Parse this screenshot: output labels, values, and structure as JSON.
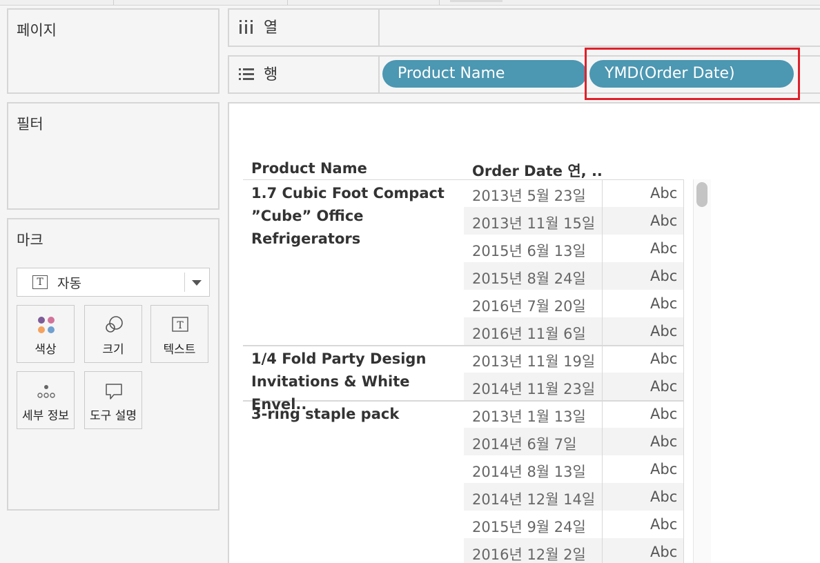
{
  "panels": {
    "pages": {
      "title": "페이지"
    },
    "filters": {
      "title": "필터"
    },
    "marks": {
      "title": "마크",
      "dropdown": {
        "icon": "text-icon",
        "label": "자동"
      },
      "buttons": [
        {
          "label": "색상",
          "icon": "color-dots-icon"
        },
        {
          "label": "크기",
          "icon": "size-icon"
        },
        {
          "label": "텍스트",
          "icon": "text-icon"
        },
        {
          "label": "세부 정보",
          "icon": "detail-dots-icon"
        },
        {
          "label": "도구 설명",
          "icon": "tooltip-icon"
        }
      ]
    }
  },
  "shelves": {
    "columns": {
      "label": "열",
      "icon": "columns-icon",
      "pills": []
    },
    "rows": {
      "label": "행",
      "icon": "rows-icon",
      "pills": [
        "Product Name",
        "YMD(Order Date)"
      ]
    }
  },
  "table": {
    "headers": [
      "Product Name",
      "Order Date 연, .."
    ],
    "marker": "Abc",
    "groups": [
      {
        "product": "1.7 Cubic Foot Compact ”Cube” Office Refrigerators",
        "dates": [
          "2013년 5월 23일",
          "2013년 11월 15일",
          "2015년 6월 13일",
          "2015년 8월 24일",
          "2016년 7월 20일",
          "2016년 11월 6일"
        ]
      },
      {
        "product": "1/4 Fold Party Design Invitations & White Envel..",
        "dates": [
          "2013년 11월 19일",
          "2014년 11월 23일"
        ]
      },
      {
        "product": "3-ring staple pack",
        "dates": [
          "2013년 1월 13일",
          "2014년 6월 7일",
          "2014년 8월 13일",
          "2014년 12월 14일",
          "2015년 9월 24일",
          "2016년 12월 2일"
        ]
      }
    ]
  },
  "colors": {
    "pill": "#4c97b2",
    "highlight": "#e0202a"
  }
}
